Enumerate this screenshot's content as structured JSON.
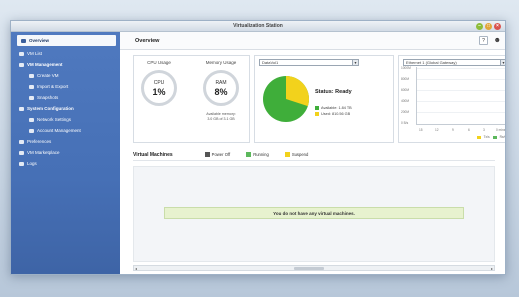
{
  "window": {
    "title": "Virtualization Station"
  },
  "sidebar": {
    "items": [
      {
        "label": "Overview",
        "icon": "overview-icon"
      },
      {
        "label": "VM List",
        "icon": "list-icon"
      },
      {
        "label": "VM Management",
        "icon": "management-icon"
      },
      {
        "label": "Create VM",
        "icon": "create-icon"
      },
      {
        "label": "Import & Export",
        "icon": "import-export-icon"
      },
      {
        "label": "Snapshots",
        "icon": "snapshot-icon"
      },
      {
        "label": "System Configuration",
        "icon": "config-icon"
      },
      {
        "label": "Network Settings",
        "icon": "network-icon"
      },
      {
        "label": "Account Management",
        "icon": "account-icon"
      },
      {
        "label": "Preferences",
        "icon": "preferences-icon"
      },
      {
        "label": "VM Marketplace",
        "icon": "marketplace-icon"
      },
      {
        "label": "Logs",
        "icon": "logs-icon"
      }
    ]
  },
  "header": {
    "title": "Overview",
    "help_label": "?",
    "user_label": "☰"
  },
  "resources": {
    "cpu_label": "CPU Usage",
    "cpu_name": "CPU",
    "cpu_value": "1%",
    "ram_label": "Memory Usage",
    "ram_name": "RAM",
    "ram_value": "8%",
    "ram_available": "Available memory:",
    "ram_detail": "3.0 GB of 3.1 GB"
  },
  "storage": {
    "dropdown_value": "DataVol1",
    "status": "Status: Ready",
    "available_label": "Available: 1.84 TB",
    "used_label": "Used: 810.56 GB",
    "available_color": "#3fae3a",
    "used_color": "#f2d21c",
    "used_fraction": 0.3
  },
  "network": {
    "dropdown_value": "Ethernet 1 (Global Gateway)",
    "y_ticks": [
      "1000M",
      "800M",
      "600M",
      "400M",
      "200M",
      "0 B/s"
    ],
    "x_ticks": [
      "15",
      "12",
      "9",
      "6",
      "3",
      "0 mins"
    ],
    "legend_tx": "Tx/s",
    "legend_rx": "Rx/s"
  },
  "virtual_machines": {
    "title": "Virtual Machines",
    "legend": [
      {
        "label": "Power Off",
        "color": "#555555"
      },
      {
        "label": "Running",
        "color": "#5cb85c"
      },
      {
        "label": "Suspend",
        "color": "#f2d21c"
      }
    ],
    "empty_message": "You do not have any virtual machines."
  }
}
